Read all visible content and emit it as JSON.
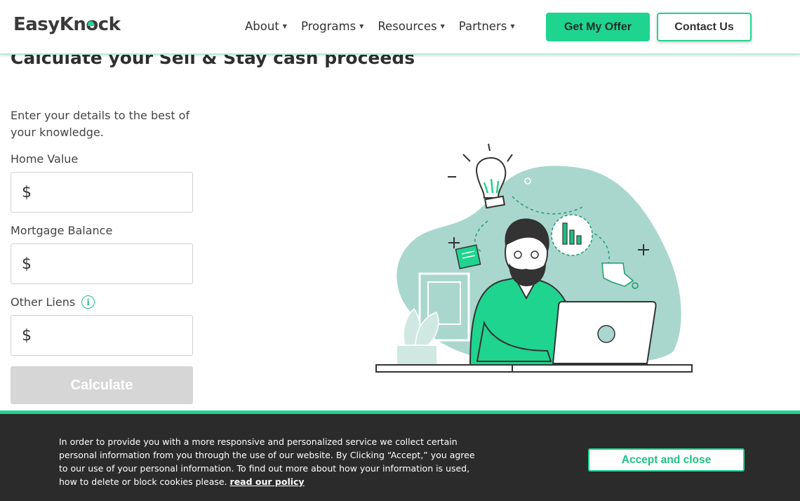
{
  "header": {
    "logo": {
      "prefix": "EasyKn",
      "o": "o",
      "suffix": "ck"
    },
    "nav": [
      {
        "label": "About"
      },
      {
        "label": "Programs"
      },
      {
        "label": "Resources"
      },
      {
        "label": "Partners"
      }
    ],
    "cta_primary": "Get My Offer",
    "cta_secondary": "Contact Us"
  },
  "page": {
    "title": "Calculate your Sell & Stay cash proceeds"
  },
  "form": {
    "intro": "Enter your details to the best of your knowledge.",
    "currency_symbol": "$",
    "fields": [
      {
        "label": "Home Value",
        "value": ""
      },
      {
        "label": "Mortgage Balance",
        "value": ""
      },
      {
        "label": "Other Liens",
        "value": ""
      }
    ],
    "submit": "Calculate"
  },
  "cookie_banner": {
    "text": "In order to provide you with a more responsive and personalized service we collect certain personal information from you through the use of our website. By Clicking “Accept,” you agree to our use of your personal information. To find out more about how your information is used, how to delete or block cookies please.",
    "link": "read our policy",
    "accept": "Accept and close"
  },
  "colors": {
    "brand_green": "#1fd48f",
    "illustration_teal": "#a9d7cd",
    "banner_bg": "#2b2b2b",
    "disabled_button": "#d6d6d6"
  },
  "icons": [
    "caret-down-icon",
    "info-icon"
  ]
}
